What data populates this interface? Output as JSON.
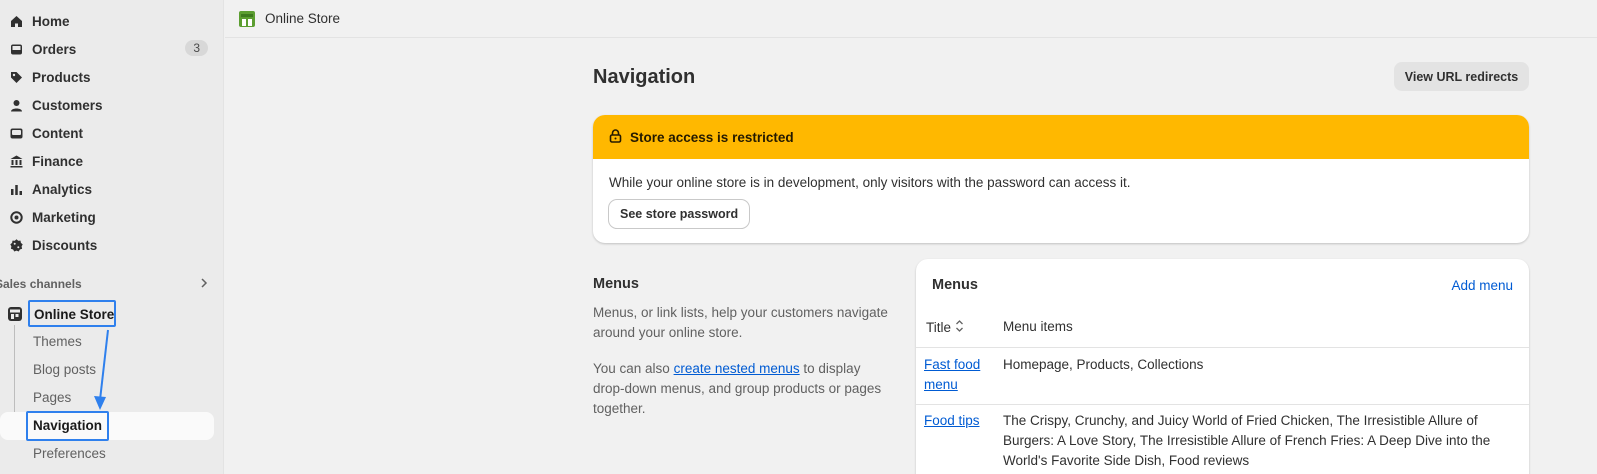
{
  "sidebar": {
    "items": [
      {
        "label": "Home",
        "icon": "home-icon"
      },
      {
        "label": "Orders",
        "icon": "inbox-icon",
        "badge": "3"
      },
      {
        "label": "Products",
        "icon": "tag-icon"
      },
      {
        "label": "Customers",
        "icon": "person-icon"
      },
      {
        "label": "Content",
        "icon": "image-icon"
      },
      {
        "label": "Finance",
        "icon": "bank-icon"
      },
      {
        "label": "Analytics",
        "icon": "bar-chart-icon"
      },
      {
        "label": "Marketing",
        "icon": "target-icon"
      },
      {
        "label": "Discounts",
        "icon": "discount-icon"
      }
    ],
    "sales_channels": {
      "title": "Sales channels",
      "store": "Online Store",
      "sub_items": [
        "Themes",
        "Blog posts",
        "Pages",
        "Navigation",
        "Preferences"
      ]
    }
  },
  "topbar": {
    "title": "Online Store"
  },
  "page": {
    "title": "Navigation",
    "redirects_button": "View URL redirects"
  },
  "banner": {
    "title": "Store access is restricted",
    "message": "While your online store is in development, only visitors with the password can access it.",
    "button": "See store password",
    "color": "#ffb800"
  },
  "menus_section": {
    "heading": "Menus",
    "desc1": "Menus, or link lists, help your customers navigate around your online store.",
    "desc2_prefix": "You can also ",
    "desc2_link": "create nested menus",
    "desc2_suffix": " to display drop-down menus, and group products or pages together."
  },
  "menus_card": {
    "title": "Menus",
    "add_label": "Add menu",
    "col_title": "Title",
    "col_items": "Menu items",
    "rows": [
      {
        "title": "Fast food menu",
        "items": "Homepage, Products, Collections"
      },
      {
        "title": "Food tips",
        "items": "The Crispy, Crunchy, and Juicy World of Fried Chicken, The Irresistible Allure of Burgers: A Love Story, The Irresistible Allure of French Fries: A Deep Dive into the World's Favorite Side Dish, Food reviews"
      }
    ]
  },
  "colors": {
    "link": "#005bd3",
    "annotation": "#2f80ed"
  }
}
